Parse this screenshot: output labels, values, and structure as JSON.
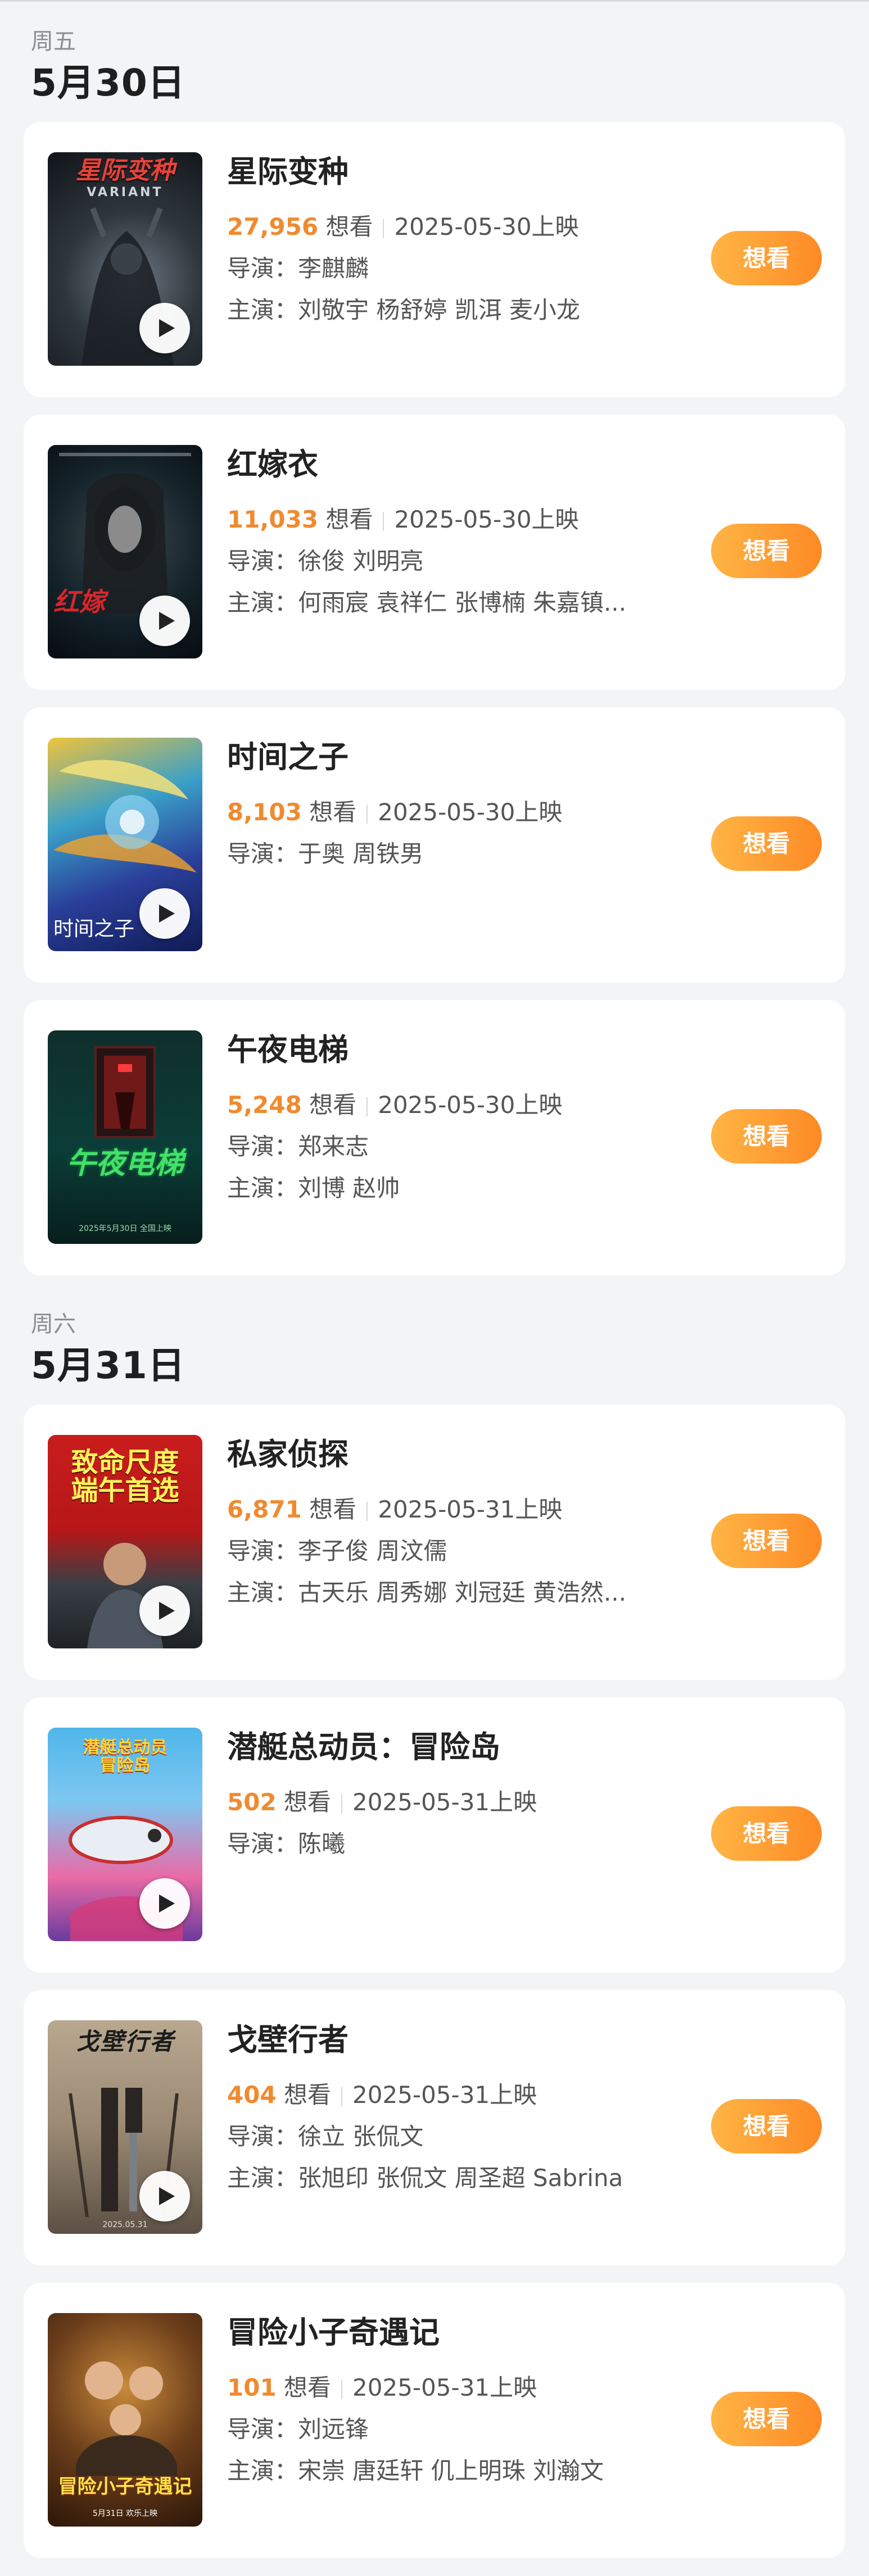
{
  "sections": [
    {
      "weekday": "周五",
      "date": "5月30日",
      "movies": [
        {
          "title": "星际变种",
          "want_count": "27,956",
          "want_label": "想看",
          "release": "2025-05-30上映",
          "director": "导演：李麒麟",
          "cast": "主演：刘敬宇 杨舒婷 凯洱 麦小龙",
          "button": "想看",
          "poster": {
            "text": "星际变种",
            "subtext": "VARIANT"
          }
        },
        {
          "title": "红嫁衣",
          "want_count": "11,033",
          "want_label": "想看",
          "release": "2025-05-30上映",
          "director": "导演：徐俊 刘明亮",
          "cast": "主演：何雨宸 袁祥仁 张博楠 朱嘉镇...",
          "button": "想看",
          "poster": {
            "text": "红嫁",
            "subtext": ""
          }
        },
        {
          "title": "时间之子",
          "want_count": "8,103",
          "want_label": "想看",
          "release": "2025-05-30上映",
          "director": "导演：于奥  周铁男",
          "cast": "",
          "button": "想看",
          "poster": {
            "text": "时间之子",
            "subtext": ""
          }
        },
        {
          "title": "午夜电梯",
          "want_count": "5,248",
          "want_label": "想看",
          "release": "2025-05-30上映",
          "director": "导演：郑来志",
          "cast": "主演：刘博 赵帅",
          "button": "想看",
          "poster": {
            "text": "午夜电梯",
            "subtext": "2025年5月30日  全国上映"
          }
        }
      ]
    },
    {
      "weekday": "周六",
      "date": "5月31日",
      "movies": [
        {
          "title": "私家侦探",
          "want_count": "6,871",
          "want_label": "想看",
          "release": "2025-05-31上映",
          "director": "导演：李子俊  周汶儒",
          "cast": "主演：古天乐 周秀娜 刘冠廷 黄浩然...",
          "button": "想看",
          "poster": {
            "text": "致命尺度\n端午首选",
            "subtext": ""
          }
        },
        {
          "title": "潜艇总动员：冒险岛",
          "want_count": "502",
          "want_label": "想看",
          "release": "2025-05-31上映",
          "director": "导演：陈曦",
          "cast": "",
          "button": "想看",
          "poster": {
            "text": "潜艇总动员\n冒险岛",
            "subtext": ""
          }
        },
        {
          "title": "戈壁行者",
          "want_count": "404",
          "want_label": "想看",
          "release": "2025-05-31上映",
          "director": "导演：徐立  张侃文",
          "cast": "主演：张旭印 张侃文 周圣超 Sabrina",
          "button": "想看",
          "poster": {
            "text": "戈壁行者",
            "subtext": "2025.05.31"
          }
        },
        {
          "title": "冒险小子奇遇记",
          "want_count": "101",
          "want_label": "想看",
          "release": "2025-05-31上映",
          "director": "导演：刘远锋",
          "cast": "主演：宋崇 唐廷轩 仉上明珠 刘瀚文",
          "button": "想看",
          "poster": {
            "text": "冒险小子奇遇记",
            "subtext": "5月31日  欢乐上映"
          }
        }
      ]
    }
  ],
  "colors": {
    "background": "#f3f4f6",
    "card": "#ffffff",
    "accent_count": "#f08a2f",
    "button_gradient_start": "#ffb545",
    "button_gradient_end": "#fe8a25",
    "weekday_text": "#8a8d93"
  },
  "icons": {
    "play": "play-icon"
  }
}
